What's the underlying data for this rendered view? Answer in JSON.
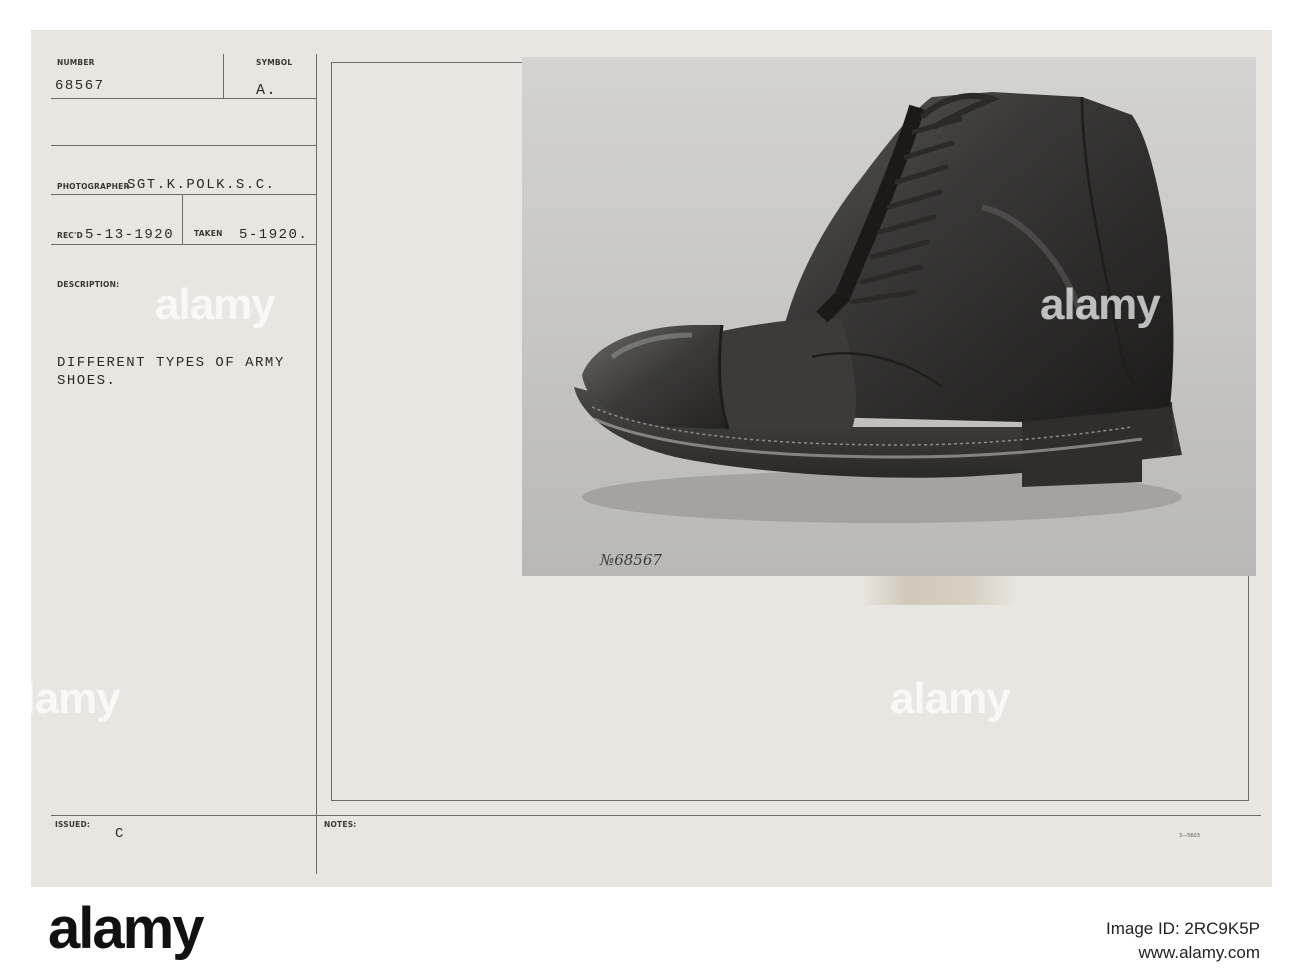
{
  "card": {
    "number_label": "NUMBER",
    "number_value": "68567",
    "symbol_label": "SYMBOL",
    "symbol_value": "A.",
    "photographer_label": "PHOTOGRAPHER",
    "photographer_value": "SGT.K.POLK.S.C.",
    "recd_label": "REC'D",
    "recd_value": "5-13-1920",
    "taken_label": "TAKEN",
    "taken_value": "5-1920.",
    "description_label": "DESCRIPTION:",
    "description_line1": "DIFFERENT TYPES OF ARMY",
    "description_line2": "SHOES.",
    "issued_label": "ISSUED:",
    "issued_value": "C",
    "notes_label": "NOTES:",
    "form_code": "3—5603"
  },
  "photo": {
    "handwritten_number": "№68567",
    "subject": "army-boot"
  },
  "watermark": "alamy",
  "footer": {
    "logo": "alamy",
    "image_id_label": "Image ID: 2RC9K5P",
    "site": "www.alamy.com"
  }
}
